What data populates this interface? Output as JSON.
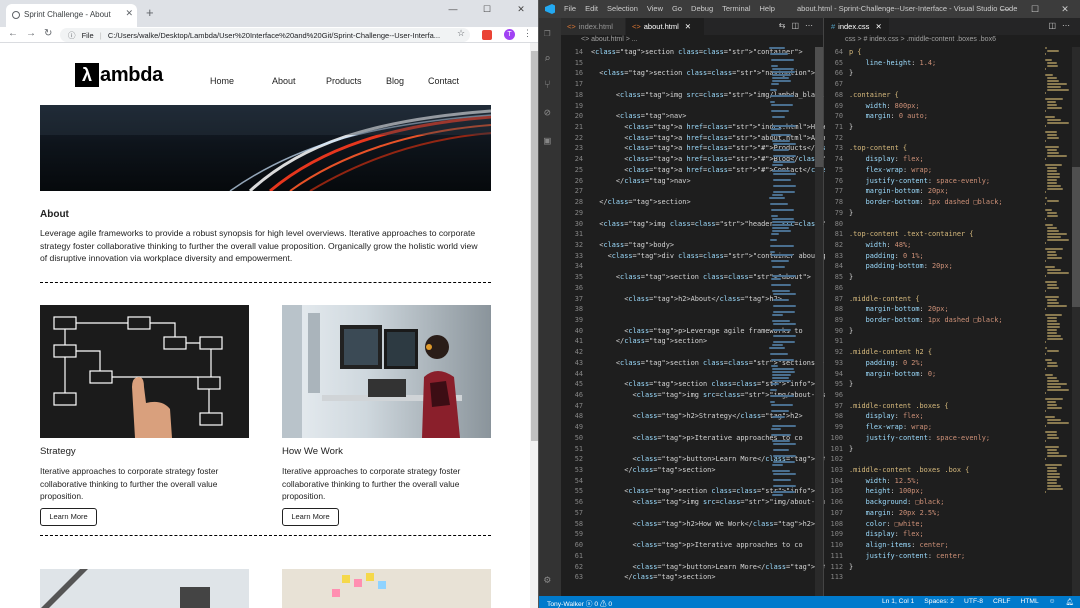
{
  "browser": {
    "tab_title": "Sprint Challenge - About",
    "url_prefix": "File",
    "url": "C:/Users/walke/Desktop/Lambda/User%20Interface%20and%20Git/Sprint-Challenge--User-Interfa...",
    "profile_initial": "T"
  },
  "site": {
    "logo_mark": "λ",
    "logo_word": "ambda",
    "nav": [
      "Home",
      "About",
      "Products",
      "Blog",
      "Contact"
    ],
    "about_heading": "About",
    "about_text": "Leverage agile frameworks to provide a robust synopsis for high level overviews. Iterative approaches to corporate strategy foster collaborative thinking to further the overall value proposition. Organically grow the holistic world view of disruptive innovation via workplace diversity and empowerment.",
    "boxes": [
      {
        "heading": "Strategy",
        "text": "Iterative approaches to corporate strategy foster collaborative thinking to further the overall value proposition.",
        "button": "Learn More"
      },
      {
        "heading": "How We Work",
        "text": "Iterative approaches to corporate strategy foster collaborative thinking to further the overall value proposition.",
        "button": "Learn More"
      }
    ]
  },
  "vscode": {
    "menus": [
      "File",
      "Edit",
      "Selection",
      "View",
      "Go",
      "Debug",
      "Terminal",
      "Help"
    ],
    "title": "about.html - Sprint-Challenge--User-Interface - Visual Studio Code",
    "left_tabs": [
      "index.html",
      "about.html"
    ],
    "right_tabs": [
      "index.css"
    ],
    "left_crumb": "<> about.html > ...",
    "right_crumb": "css > # index.css > .middle-content .boxes .box6",
    "status_left": "Tony-Walker   ⓧ 0 ⚠ 0",
    "status_right": [
      "Ln 1, Col 1",
      "Spaces: 2",
      "UTF-8",
      "CRLF",
      "HTML"
    ],
    "html_start_line": 14,
    "html_lines": [
      "<section class=\"container\">",
      "",
      "  <section class=\"navigation\">",
      "",
      "      <img src=\"img/lambda_black.png\">",
      "",
      "      <nav>",
      "        <a href=\"index.html\">Home</a>",
      "        <a href=\"about.html\">About</a>",
      "        <a href=\"#\">Products</a>",
      "        <a href=\"#\">Blog</a>",
      "        <a href=\"#\">Contact</a>",
      "      </nav>",
      "",
      "  </section>",
      "",
      "  <img class=\"header\" src=\"img/jumbo.jpg\"",
      "",
      "  <body>",
      "    <div class=\"container about-page\">",
      "",
      "      <section class=\"about\">",
      "",
      "        <h2>About</h2>",
      "",
      "",
      "        <p>Leverage agile frameworks to",
      "      </section>",
      "",
      "      <section class=\"sections\">",
      "",
      "        <section class=\"info\">",
      "          <img src=\"img/about-plan.png\"",
      "",
      "          <h2>Strategy</h2>",
      "",
      "          <p>Iterative approaches to co",
      "",
      "          <button>Learn More</button>",
      "        </section>",
      "",
      "        <section class=\"info\">",
      "          <img src=\"img/about-working.p",
      "",
      "          <h2>How We Work</h2>",
      "",
      "          <p>Iterative approaches to co",
      "",
      "          <button>Learn More</button>",
      "        </section>"
    ],
    "css_start_line": 64,
    "css_lines": [
      "p {",
      "    line-height: 1.4;",
      "}",
      "",
      ".container {",
      "    width: 800px;",
      "    margin: 0 auto;",
      "}",
      "",
      ".top-content {",
      "    display: flex;",
      "    flex-wrap: wrap;",
      "    justify-content: space-evenly;",
      "    margin-bottom: 20px;",
      "    border-bottom: 1px dashed □black;",
      "}",
      "",
      ".top-content .text-container {",
      "    width: 48%;",
      "    padding: 0 1%;",
      "    padding-bottom: 20px;",
      "}",
      "",
      ".middle-content {",
      "    margin-bottom: 20px;",
      "    border-bottom: 1px dashed □black;",
      "}",
      "",
      ".middle-content h2 {",
      "    padding: 0 2%;",
      "    margin-bottom: 0;",
      "}",
      "",
      ".middle-content .boxes {",
      "    display: flex;",
      "    flex-wrap: wrap;",
      "    justify-content: space-evenly;",
      "}",
      "",
      ".middle-content .boxes .box {",
      "    width: 12.5%;",
      "    height: 100px;",
      "    background: □black;",
      "    margin: 20px 2.5%;",
      "    color: □white;",
      "    display: flex;",
      "    align-items: center;",
      "    justify-content: center;",
      "}",
      ""
    ]
  }
}
